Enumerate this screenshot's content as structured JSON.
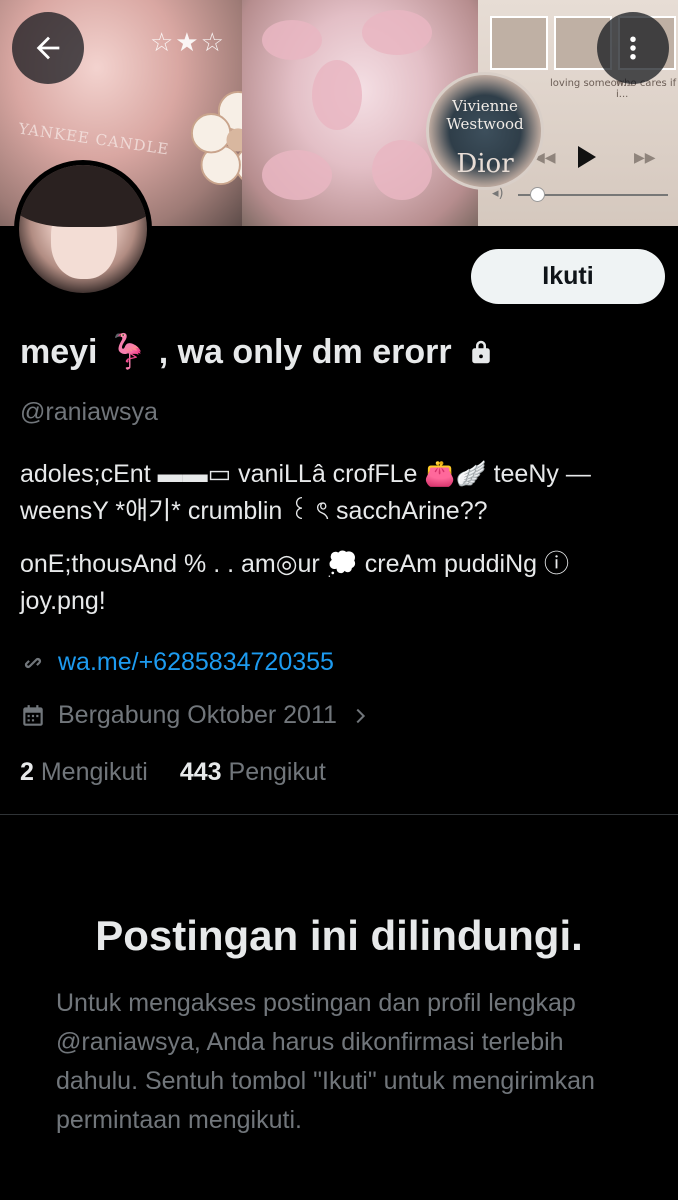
{
  "banner": {
    "candle_label": "YANKEE CANDLE",
    "music_captions": [
      "loving someon...",
      "who cares if i..."
    ],
    "logo_line1": "Vivienne",
    "logo_line2": "Westwood",
    "logo_line3": "Dior"
  },
  "header": {
    "back_label": "Back",
    "more_label": "More"
  },
  "profile": {
    "follow_label": "Ikuti",
    "display_name": "meyi 🦩 , wa only dm erorr",
    "handle": "@raniawsya",
    "bio_line1": "adoles;cEnt ▬▬▭ vaniLLâ crofFLe 👛🪽 teeNy —weensY *애기* crumblin ꒰ ৎ sacchArine??",
    "bio_line2": "onE;thousAnd % . . am◎ur 💭 creAm puddiNg ⓘ joy.png!",
    "link": "wa.me/+6285834720355",
    "joined": "Bergabung Oktober 2011",
    "following_count": "2",
    "following_label": "Mengikuti",
    "followers_count": "443",
    "followers_label": "Pengikut"
  },
  "protected": {
    "title": "Postingan ini dilindungi.",
    "body": "Untuk mengakses postingan dan profil lengkap @raniawsya, Anda harus dikonfirmasi terlebih dahulu. Sentuh tombol \"Ikuti\" untuk mengirimkan permintaan mengikuti."
  },
  "colors": {
    "background": "#000000",
    "text_primary": "#e7e9ea",
    "text_secondary": "#71767b",
    "link": "#1d9bf0",
    "button_bg": "#eff3f4",
    "divider": "#2f3336"
  },
  "icons": {
    "back": "arrow-left-icon",
    "more": "vertical-dots-icon",
    "lock": "lock-icon",
    "link": "link-icon",
    "calendar": "calendar-icon",
    "chevron": "chevron-right-icon"
  }
}
